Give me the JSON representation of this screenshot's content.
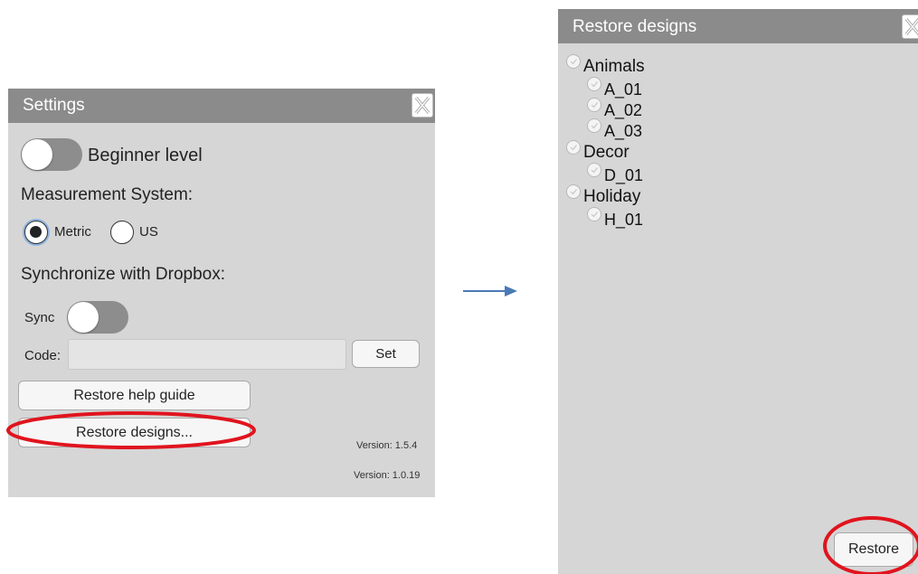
{
  "settings": {
    "title": "Settings",
    "beginner_label": "Beginner level",
    "measurement_label": "Measurement System:",
    "radio_metric": "Metric",
    "radio_us": "US",
    "dropbox_label": "Synchronize with Dropbox:",
    "sync_label": "Sync",
    "code_label": "Code:",
    "code_value": "",
    "set_button": "Set",
    "restore_help_button": "Restore help guide",
    "restore_designs_button": "Restore designs...",
    "version_1": "Version: 1.5.4",
    "version_2": "Version: 1.0.19"
  },
  "restore": {
    "title": "Restore designs",
    "tree": [
      {
        "label": "Animals",
        "level": 0
      },
      {
        "label": "A_01",
        "level": 1
      },
      {
        "label": "A_02",
        "level": 1
      },
      {
        "label": "A_03",
        "level": 1
      },
      {
        "label": "Decor",
        "level": 0
      },
      {
        "label": "D_01",
        "level": 1
      },
      {
        "label": "Holiday",
        "level": 0
      },
      {
        "label": "H_01",
        "level": 1
      }
    ],
    "restore_button": "Restore"
  },
  "colors": {
    "panel_bg": "#d6d6d6",
    "titlebar_bg": "#8b8b8b",
    "highlight_red": "#e0141e",
    "arrow_blue": "#4a7ab5"
  }
}
